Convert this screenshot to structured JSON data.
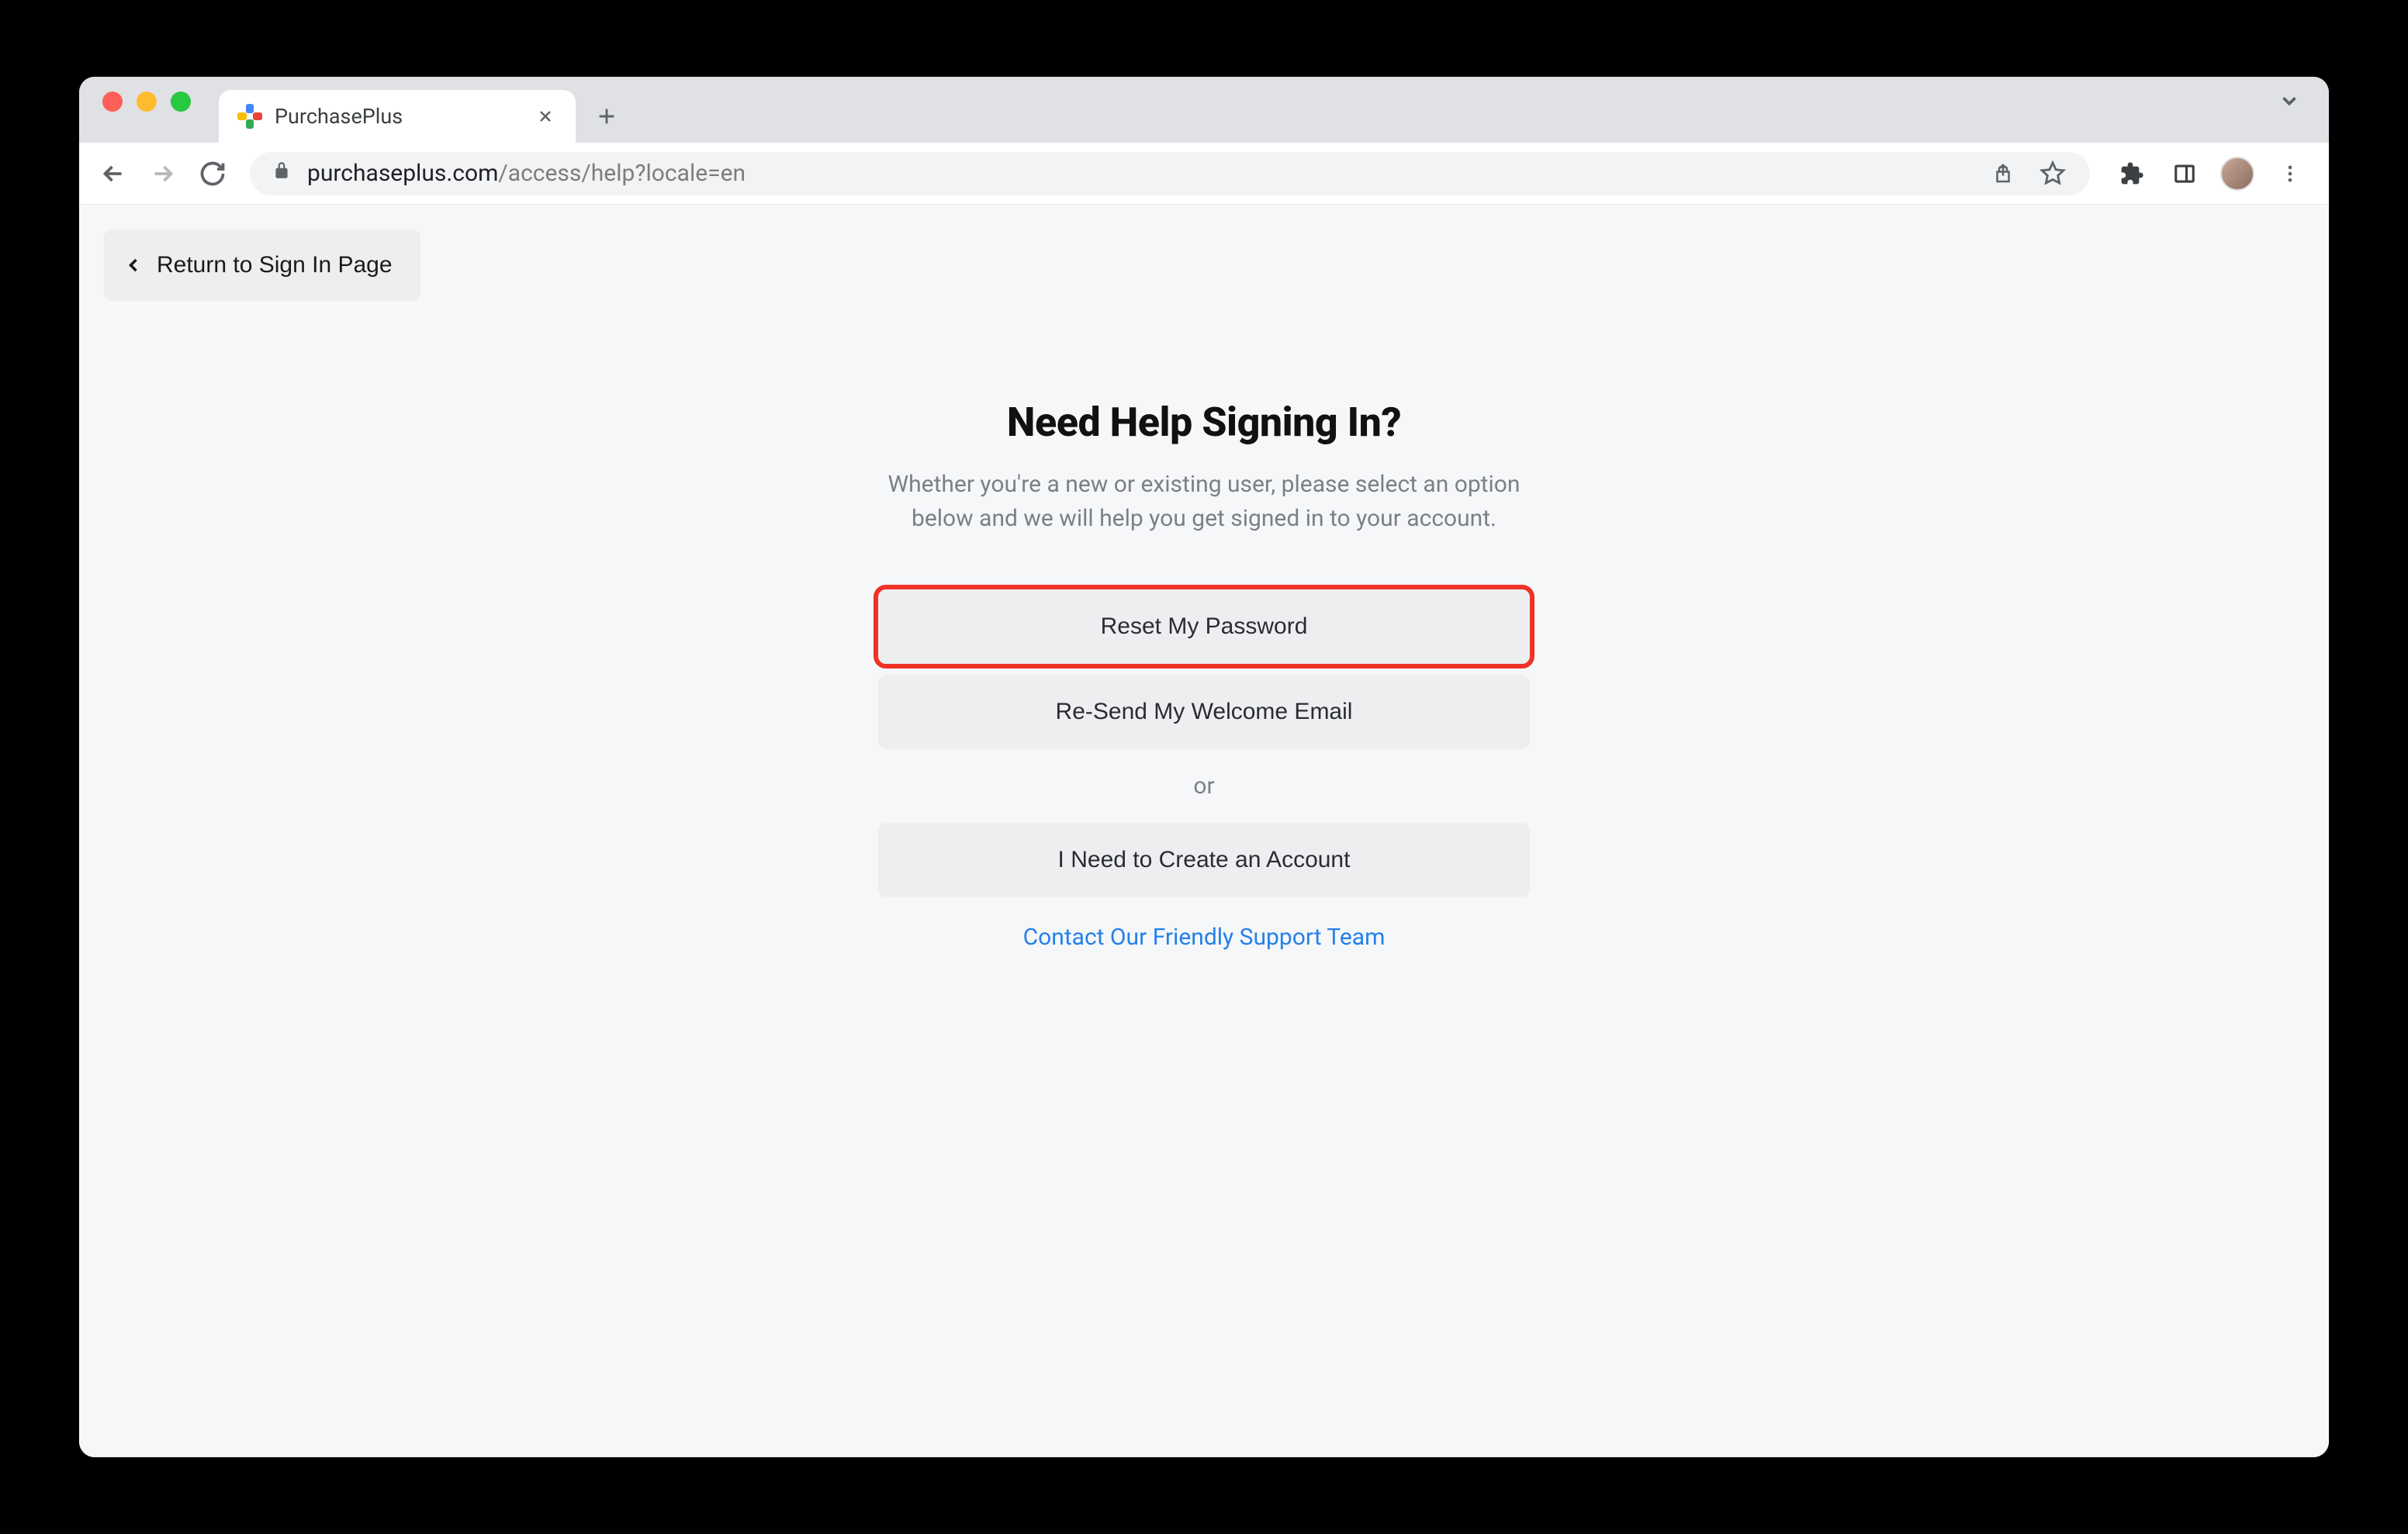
{
  "browser": {
    "tab_title": "PurchasePlus",
    "url_domain": "purchaseplus.com",
    "url_path": "/access/help?locale=en"
  },
  "page": {
    "return_label": "Return to Sign In Page",
    "heading": "Need Help Signing In?",
    "subheading": "Whether you're a new or existing user, please select an option below and we will help you get signed in to your account.",
    "reset_password_label": "Reset My Password",
    "resend_welcome_label": "Re-Send My Welcome Email",
    "or_label": "or",
    "create_account_label": "I Need to Create an Account",
    "support_link_label": "Contact Our Friendly Support Team"
  }
}
